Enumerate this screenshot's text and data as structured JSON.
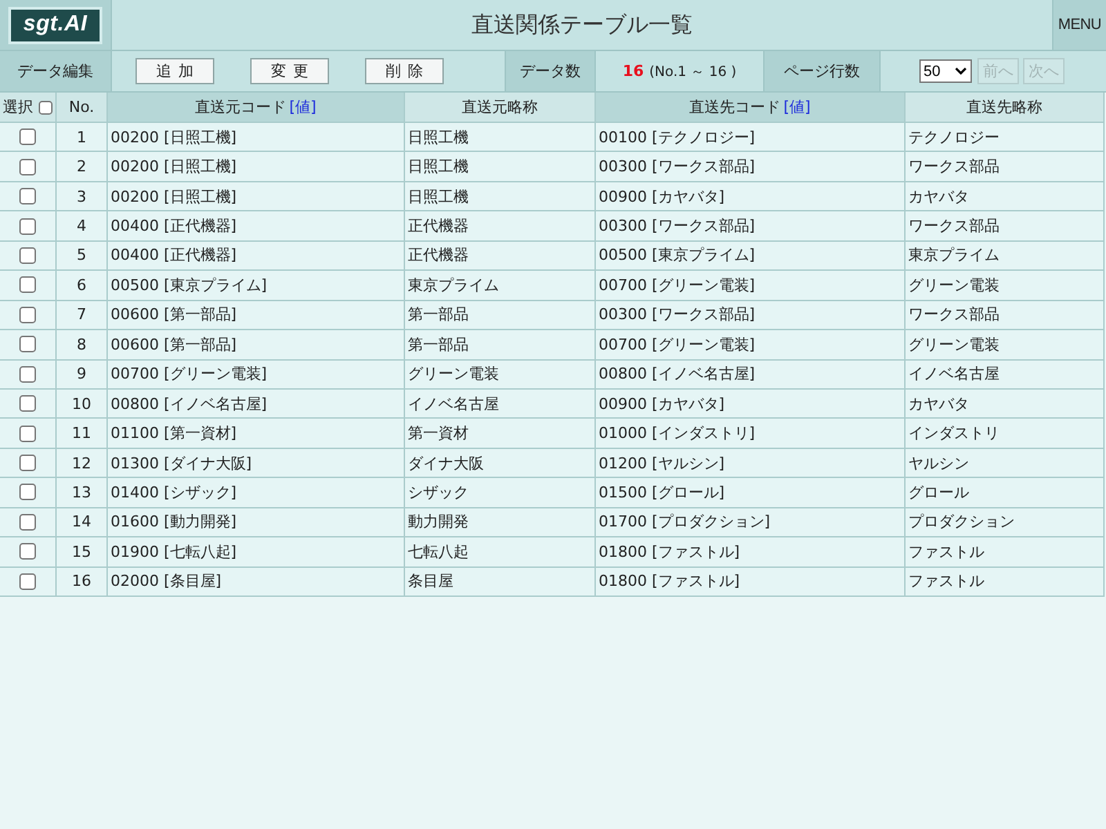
{
  "header": {
    "logo": "sgt.AI",
    "title": "直送関係テーブル一覧",
    "menu": "MENU"
  },
  "toolbar": {
    "edit_label": "データ編集",
    "buttons": [
      "追加",
      "変更",
      "削除"
    ],
    "count_label": "データ数",
    "count": "16",
    "range": "(No.1 ～ 16 )",
    "page_rows_label": "ページ行数",
    "page_rows": "50",
    "pager": [
      {
        "label": "前へ",
        "disabled": true
      },
      {
        "label": "次へ",
        "disabled": true
      }
    ]
  },
  "table": {
    "select_label": "選択",
    "select_all_checked": false,
    "columns": [
      {
        "label": "No.",
        "kind": "number"
      },
      {
        "label": "直送元コード",
        "link": "[値]",
        "kind": "code"
      },
      {
        "label": "直送元略称",
        "kind": "name"
      },
      {
        "label": "直送先コード",
        "link": "[値]",
        "kind": "code"
      },
      {
        "label": "直送先略称",
        "kind": "name"
      }
    ],
    "rows": [
      {
        "checked": false,
        "no": "1",
        "cells": [
          "00200 [日照工機]",
          "日照工機",
          "00100 [テクノロジー]",
          "テクノロジー"
        ]
      },
      {
        "checked": false,
        "no": "2",
        "cells": [
          "00200 [日照工機]",
          "日照工機",
          "00300 [ワークス部品]",
          "ワークス部品"
        ]
      },
      {
        "checked": false,
        "no": "3",
        "cells": [
          "00200 [日照工機]",
          "日照工機",
          "00900 [カヤバタ]",
          "カヤバタ"
        ]
      },
      {
        "checked": false,
        "no": "4",
        "cells": [
          "00400 [正代機器]",
          "正代機器",
          "00300 [ワークス部品]",
          "ワークス部品"
        ]
      },
      {
        "checked": false,
        "no": "5",
        "cells": [
          "00400 [正代機器]",
          "正代機器",
          "00500 [東京プライム]",
          "東京プライム"
        ]
      },
      {
        "checked": false,
        "no": "6",
        "cells": [
          "00500 [東京プライム]",
          "東京プライム",
          "00700 [グリーン電装]",
          "グリーン電装"
        ]
      },
      {
        "checked": false,
        "no": "7",
        "cells": [
          "00600 [第一部品]",
          "第一部品",
          "00300 [ワークス部品]",
          "ワークス部品"
        ]
      },
      {
        "checked": false,
        "no": "8",
        "cells": [
          "00600 [第一部品]",
          "第一部品",
          "00700 [グリーン電装]",
          "グリーン電装"
        ]
      },
      {
        "checked": false,
        "no": "9",
        "cells": [
          "00700 [グリーン電装]",
          "グリーン電装",
          "00800 [イノベ名古屋]",
          "イノベ名古屋"
        ]
      },
      {
        "checked": false,
        "no": "10",
        "cells": [
          "00800 [イノベ名古屋]",
          "イノベ名古屋",
          "00900 [カヤバタ]",
          "カヤバタ"
        ]
      },
      {
        "checked": false,
        "no": "11",
        "cells": [
          "01100 [第一資材]",
          "第一資材",
          "01000 [インダストリ]",
          "インダストリ"
        ]
      },
      {
        "checked": false,
        "no": "12",
        "cells": [
          "01300 [ダイナ大阪]",
          "ダイナ大阪",
          "01200 [ヤルシン]",
          "ヤルシン"
        ]
      },
      {
        "checked": false,
        "no": "13",
        "cells": [
          "01400 [シザック]",
          "シザック",
          "01500 [グロール]",
          "グロール"
        ]
      },
      {
        "checked": false,
        "no": "14",
        "cells": [
          "01600 [動力開発]",
          "動力開発",
          "01700 [プロダクション]",
          "プロダクション"
        ]
      },
      {
        "checked": false,
        "no": "15",
        "cells": [
          "01900 [七転八起]",
          "七転八起",
          "01800 [ファストル]",
          "ファストル"
        ]
      },
      {
        "checked": false,
        "no": "16",
        "cells": [
          "02000 [条目屋]",
          "条目屋",
          "01800 [ファストル]",
          "ファストル"
        ]
      }
    ]
  }
}
